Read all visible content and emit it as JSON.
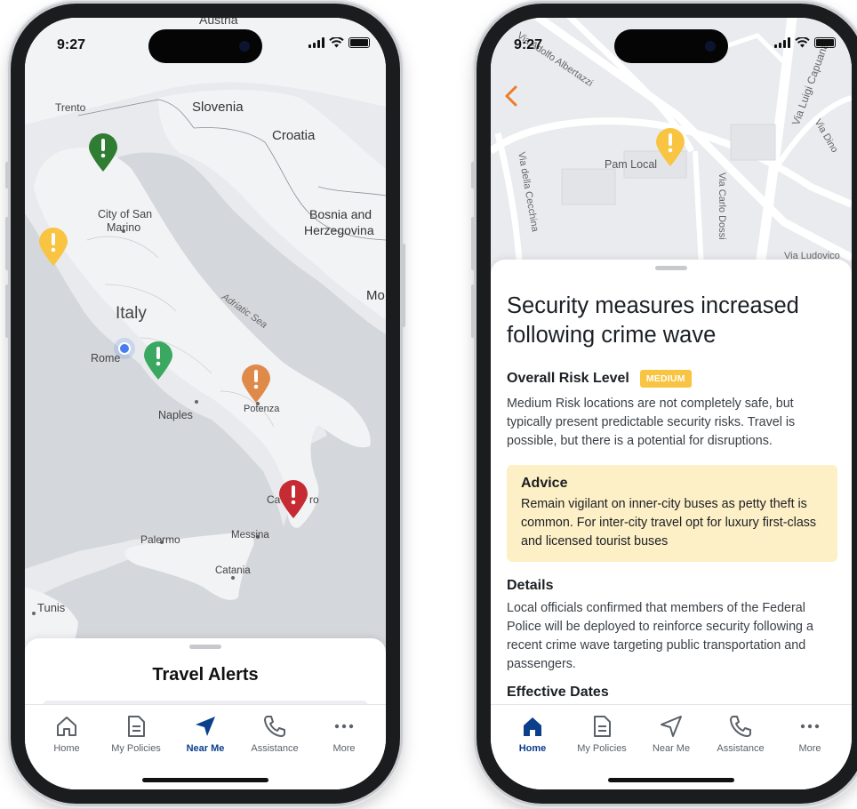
{
  "left_phone": {
    "status": {
      "time": "9:27"
    },
    "map": {
      "labels": {
        "austria": "Austria",
        "trento": "Trento",
        "slovenia": "Slovenia",
        "croatia": "Croatia",
        "bosnia": "Bosnia and",
        "herzegovina": "Herzegovina",
        "city_of_san": "City of San",
        "marino": "Marino",
        "italy": "Italy",
        "adriatic": "Adriatic Sea",
        "rome": "Rome",
        "naples": "Naples",
        "potenza": "Potenza",
        "catanzaro_a": "Ca",
        "catanzaro_b": "ro",
        "palermo": "Palermo",
        "messina": "Messina",
        "catania": "Catania",
        "tunis": "Tunis",
        "mo": "Mo"
      },
      "pins": [
        {
          "name": "alert-pin-trento",
          "color": "#2e7d32"
        },
        {
          "name": "alert-pin-tuscany",
          "color": "#f8c441"
        },
        {
          "name": "alert-pin-abruzzo",
          "color": "#3aa861"
        },
        {
          "name": "alert-pin-potenza",
          "color": "#e08a4a"
        },
        {
          "name": "alert-pin-catanzaro",
          "color": "#c62a32"
        }
      ]
    },
    "sheet": {
      "title": "Travel Alerts"
    },
    "tabbar": {
      "active": "Near Me",
      "tabs": [
        {
          "label": "Home",
          "icon": "house-icon"
        },
        {
          "label": "My Policies",
          "icon": "document-icon"
        },
        {
          "label": "Near Me",
          "icon": "navigation-arrow-icon"
        },
        {
          "label": "Assistance",
          "icon": "phone-icon"
        },
        {
          "label": "More",
          "icon": "more-dots-icon"
        }
      ]
    }
  },
  "right_phone": {
    "status": {
      "time": "9:27"
    },
    "map": {
      "labels": {
        "adolfo": "Via Adolfo Albertazzi",
        "pam": "Pam Local",
        "cecchina": "Via della Cecchina",
        "carlo_dossi": "Via Carlo Dossi",
        "luigi_capuana": "Via Luigi Capuana",
        "dino": "Via Dino",
        "ludovico": "Via Ludovico"
      },
      "pin_color": "#f8c441"
    },
    "sheet": {
      "title": "Security measures increased following crime wave",
      "risk_label": "Overall Risk Level",
      "risk_badge": "MEDIUM",
      "risk_text": "Medium Risk locations are not completely safe, but typically present predictable security risks. Travel is possible, but there is a potential for disruptions.",
      "advice_title": "Advice",
      "advice_text": "Remain vigilant on inner-city buses as petty theft is common. For inter-city travel opt for luxury first-class and licensed tourist buses",
      "details_title": "Details",
      "details_text": "Local officials confirmed that members of the Federal Police will be deployed to reinforce security following a recent crime wave targeting public transportation and passengers.",
      "dates_title": "Effective Dates"
    },
    "tabbar": {
      "active": "Home",
      "tabs": [
        {
          "label": "Home",
          "icon": "house-icon"
        },
        {
          "label": "My Policies",
          "icon": "document-icon"
        },
        {
          "label": "Near Me",
          "icon": "navigation-arrow-icon"
        },
        {
          "label": "Assistance",
          "icon": "phone-icon"
        },
        {
          "label": "More",
          "icon": "more-dots-icon"
        }
      ]
    }
  },
  "colors": {
    "accent_orange": "#f07a2c",
    "active_blue": "#0b3f8c",
    "risk_medium": "#f8c441",
    "advice_bg": "#fdefc6"
  }
}
